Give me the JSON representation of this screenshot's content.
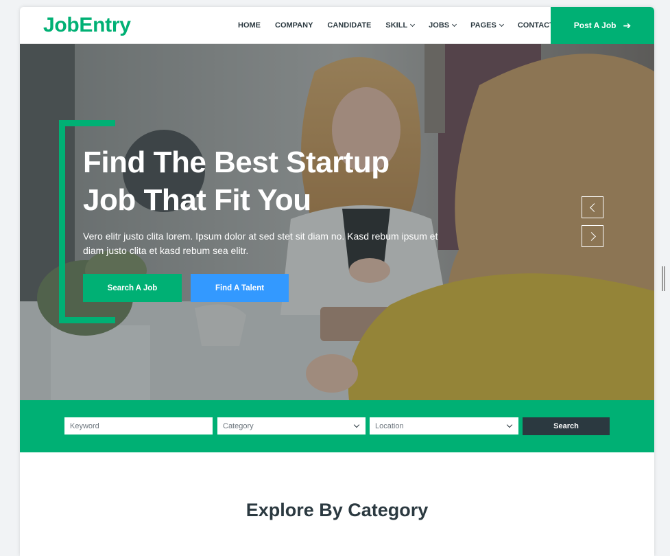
{
  "brand": {
    "name": "JobEntry"
  },
  "nav": {
    "items": [
      {
        "label": "HOME",
        "dropdown": false
      },
      {
        "label": "COMPANY",
        "dropdown": false
      },
      {
        "label": "CANDIDATE",
        "dropdown": false
      },
      {
        "label": "SKILL",
        "dropdown": true
      },
      {
        "label": "JOBS",
        "dropdown": true
      },
      {
        "label": "PAGES",
        "dropdown": true
      },
      {
        "label": "CONTACT",
        "dropdown": false
      }
    ],
    "post_job_label": "Post A Job",
    "post_job_icon": "arrow-right-icon"
  },
  "hero": {
    "title_line1": "Find The Best Startup",
    "title_line2": "Job That Fit You",
    "text": "Vero elitr justo clita lorem. Ipsum dolor at sed stet sit diam no. Kasd rebum ipsum et diam justo clita et kasd rebum sea elitr.",
    "primary_button": "Search A Job",
    "secondary_button": "Find A Talent",
    "carousel_prev_icon": "chevron-left-icon",
    "carousel_next_icon": "chevron-right-icon"
  },
  "search": {
    "keyword_placeholder": "Keyword",
    "category_value": "Category",
    "location_value": "Location",
    "button_label": "Search"
  },
  "sections": {
    "explore_title": "Explore By Category"
  },
  "colors": {
    "primary": "#00b074",
    "secondary": "#3399ff",
    "dark": "#2b3940"
  }
}
